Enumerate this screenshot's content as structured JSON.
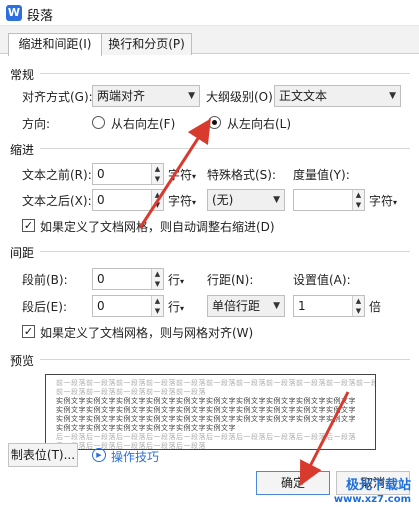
{
  "window": {
    "title": "段落",
    "app_icon_letter": "W"
  },
  "tabs": [
    {
      "label": "缩进和间距(I)"
    },
    {
      "label": "换行和分页(P)"
    }
  ],
  "general": {
    "heading": "常规",
    "align_label": "对齐方式(G):",
    "align_value": "两端对齐",
    "outline_label": "大纲级别(O):",
    "outline_value": "正文文本",
    "direction_label": "方向:",
    "rtl_label": "从右向左(F)",
    "ltr_label": "从左向右(L)"
  },
  "indent": {
    "heading": "缩进",
    "before_label": "文本之前(R):",
    "before_value": "0",
    "before_unit": "字符",
    "special_label": "特殊格式(S):",
    "special_value": "(无)",
    "measure_label": "度量值(Y):",
    "measure_value": "",
    "measure_unit": "字符",
    "after_label": "文本之后(X):",
    "after_value": "0",
    "after_unit": "字符",
    "grid_checkbox_label": "如果定义了文档网格，则自动调整右缩进(D)"
  },
  "spacing": {
    "heading": "间距",
    "before_label": "段前(B):",
    "before_value": "0",
    "before_unit": "行",
    "line_label": "行距(N):",
    "line_value": "单倍行距",
    "setting_label": "设置值(A):",
    "setting_value": "1",
    "setting_unit": "倍",
    "after_label": "段后(E):",
    "after_value": "0",
    "after_unit": "行",
    "grid_checkbox_label": "如果定义了文档网格，则与网格对齐(W)"
  },
  "preview": {
    "heading": "预览",
    "prev_lines": [
      "前一段落前一段落前一段落前一段落前一段落前一段落前一段落前一段落前一段落前一段落前一段落",
      "前一段落前一段落前一段落前一段落前一段落"
    ],
    "sample_lines": [
      "实例文字实例文字实例文字实例文字实例文字实例文字实例文字实例文字实例文字实例文字",
      "实例文字实例文字实例文字实例文字实例文字实例文字实例文字实例文字实例文字实例文字",
      "实例文字实例文字实例文字实例文字实例文字实例文字实例文字实例文字实例文字实例文字",
      "实例文字实例文字实例文字实例文字实例文字实例文字"
    ],
    "next_lines": [
      "后一段落后一段落后一段落后一段落后一段落后一段落后一段落后一段落后一段落后一段落",
      "后一段落后一段落后一段落后一段落后一段落"
    ]
  },
  "footer": {
    "tabs_button": "制表位(T)...",
    "tips_link": "操作技巧",
    "ok_button": "确定",
    "cancel_button": "取消"
  },
  "watermark": {
    "line1": "极光下载站",
    "line2": "www.xz7.com"
  },
  "colors": {
    "annotation_arrow": "#d83a2e",
    "link": "#2a6fd6",
    "watermark": "#1e6fd9"
  }
}
